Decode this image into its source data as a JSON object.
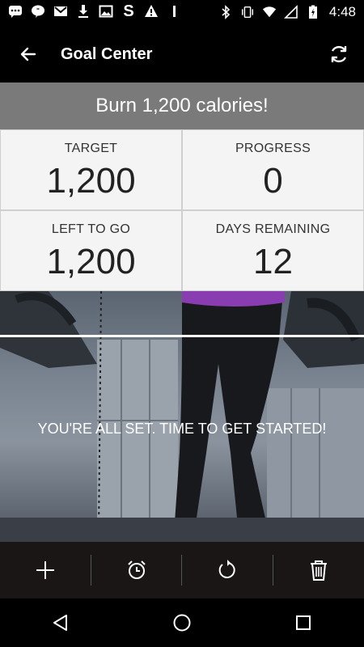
{
  "status_bar": {
    "time": "4:48",
    "left_icons": [
      "hangouts-icon",
      "chat-icon",
      "gmail-icon",
      "download-icon",
      "image-icon",
      "s-app-icon",
      "warning-icon",
      "signal-bar-icon"
    ],
    "right_icons": [
      "bluetooth-icon",
      "vibrate-icon",
      "wifi-icon",
      "cell-signal-icon",
      "battery-icon"
    ]
  },
  "app_bar": {
    "title": "Goal Center",
    "back_icon": "arrow-back-icon",
    "refresh_icon": "refresh-icon"
  },
  "goal": {
    "title": "Burn 1,200 calories!",
    "stats": [
      {
        "label": "TARGET",
        "value": "1,200"
      },
      {
        "label": "PROGRESS",
        "value": "0"
      },
      {
        "label": "LEFT TO GO",
        "value": "1,200"
      },
      {
        "label": "DAYS REMAINING",
        "value": "12"
      }
    ]
  },
  "hero": {
    "message": "YOU'RE ALL SET. TIME TO GET STARTED!"
  },
  "toolbar": {
    "buttons": [
      "add-icon",
      "alarm-icon",
      "reset-icon",
      "trash-icon"
    ]
  },
  "nav": {
    "buttons": [
      "back-triangle-icon",
      "home-circle-icon",
      "recents-square-icon"
    ]
  },
  "colors": {
    "header_band": "#7a7a7a",
    "stat_cell": "#f4f4f4",
    "toolbar": "#1a1616"
  }
}
